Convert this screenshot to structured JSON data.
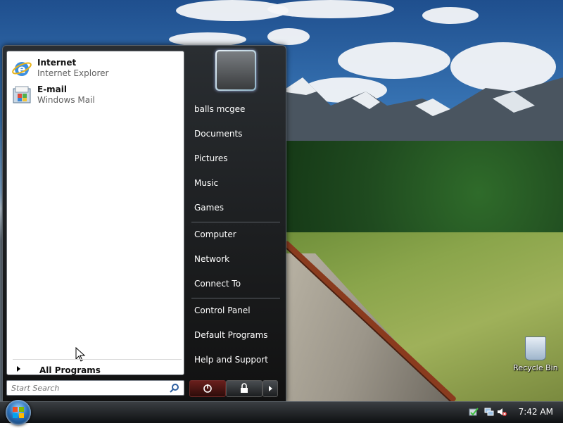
{
  "desktop": {
    "recycle_bin_label": "Recycle Bin"
  },
  "start_menu": {
    "pinned": [
      {
        "title": "Internet",
        "subtitle": "Internet Explorer",
        "icon": "internet-explorer-icon"
      },
      {
        "title": "E-mail",
        "subtitle": "Windows Mail",
        "icon": "windows-mail-icon"
      }
    ],
    "all_programs_label": "All Programs",
    "search_placeholder": "Start Search",
    "right_items": [
      "balls mcgee",
      "Documents",
      "Pictures",
      "Music",
      "Games",
      "Computer",
      "Network",
      "Connect To",
      "Control Panel",
      "Default Programs",
      "Help and Support"
    ]
  },
  "taskbar": {
    "clock": "7:42 AM"
  },
  "colors": {
    "menu_bg": "#1a1c1e",
    "accent": "#2b6fb8",
    "power_red": "#6a1f1c"
  }
}
